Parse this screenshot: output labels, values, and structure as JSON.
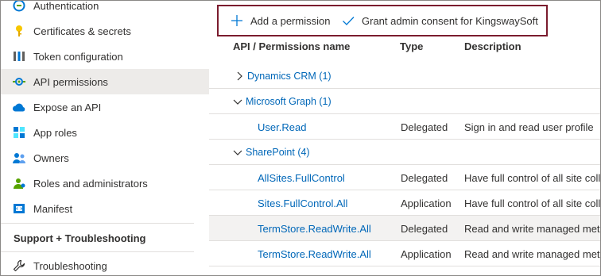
{
  "sidebar": {
    "items": [
      {
        "label": "Authentication",
        "icon": "authentication-icon"
      },
      {
        "label": "Certificates & secrets",
        "icon": "key-icon"
      },
      {
        "label": "Token configuration",
        "icon": "token-bars-icon"
      },
      {
        "label": "API permissions",
        "icon": "api-permissions-icon",
        "active": true
      },
      {
        "label": "Expose an API",
        "icon": "cloud-icon"
      },
      {
        "label": "App roles",
        "icon": "app-roles-icon"
      },
      {
        "label": "Owners",
        "icon": "owners-icon"
      },
      {
        "label": "Roles and administrators",
        "icon": "roles-admin-icon"
      },
      {
        "label": "Manifest",
        "icon": "manifest-icon"
      }
    ],
    "section_header": "Support + Troubleshooting",
    "troubleshooting_label": "Troubleshooting"
  },
  "toolbar": {
    "add_permission": "Add a permission",
    "grant_consent": "Grant admin consent for KingswaySoft",
    "border_color": "#7b1c2e"
  },
  "table": {
    "headers": {
      "name": "API / Permissions name",
      "type": "Type",
      "description": "Description"
    },
    "groups": [
      {
        "label": "Dynamics CRM (1)",
        "expanded": false
      },
      {
        "label": "Microsoft Graph (1)",
        "expanded": true
      },
      {
        "label": "SharePoint (4)",
        "expanded": true
      }
    ],
    "rows": [
      {
        "name": "User.Read",
        "type": "Delegated",
        "description": "Sign in and read user profile"
      },
      {
        "name": "AllSites.FullControl",
        "type": "Delegated",
        "description": "Have full control of all site colle"
      },
      {
        "name": "Sites.FullControl.All",
        "type": "Application",
        "description": "Have full control of all site colle"
      },
      {
        "name": "TermStore.ReadWrite.All",
        "type": "Delegated",
        "description": "Read and write managed meta"
      },
      {
        "name": "TermStore.ReadWrite.All",
        "type": "Application",
        "description": "Read and write managed meta"
      }
    ]
  },
  "colors": {
    "link": "#0067b8",
    "active_bg": "#edebe9",
    "highlight_row": "#f3f2f1"
  }
}
